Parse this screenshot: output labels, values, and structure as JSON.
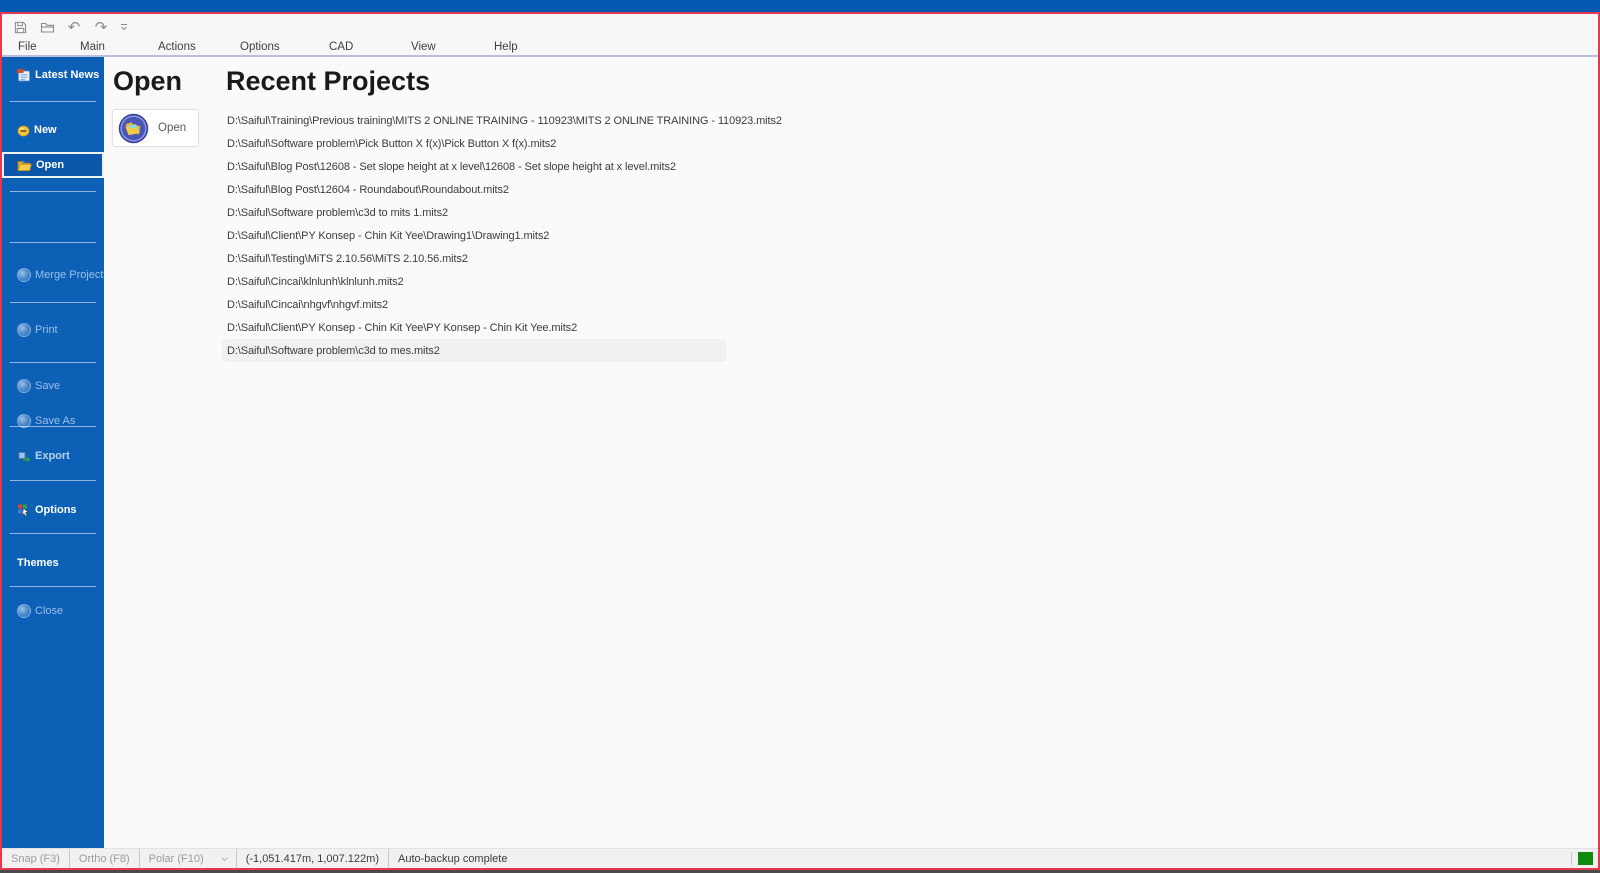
{
  "quick_access_toolbar": {
    "icons": [
      "save-icon",
      "open-folder-icon",
      "undo-icon",
      "redo-icon",
      "customize-icon"
    ]
  },
  "menu_bar": {
    "items": [
      "File",
      "Main",
      "Actions",
      "Options",
      "CAD",
      "View",
      "Help"
    ]
  },
  "sidebar": {
    "items": [
      {
        "label": "Latest News",
        "state": "enabled"
      },
      {
        "label": "New",
        "state": "enabled"
      },
      {
        "label": "Open",
        "state": "selected"
      },
      {
        "label": "Merge Project",
        "state": "disabled"
      },
      {
        "label": "Print",
        "state": "disabled"
      },
      {
        "label": "Save",
        "state": "disabled"
      },
      {
        "label": "Save As",
        "state": "disabled"
      },
      {
        "label": "Export",
        "state": "enabled"
      },
      {
        "label": "Options",
        "state": "enabled"
      },
      {
        "label": "Themes",
        "state": "enabled"
      },
      {
        "label": "Close",
        "state": "disabled"
      }
    ]
  },
  "main": {
    "section_title": "Open",
    "open_button_label": "Open",
    "recent_title": "Recent Projects",
    "recent_projects": [
      "D:\\Saiful\\Training\\Previous training\\MITS 2 ONLINE TRAINING - 110923\\MITS 2 ONLINE TRAINING - 110923.mits2",
      "D:\\Saiful\\Software problem\\Pick Button X f(x)\\Pick Button X f(x).mits2",
      "D:\\Saiful\\Blog Post\\12608 - Set slope height at x level\\12608 - Set slope height at x level.mits2",
      "D:\\Saiful\\Blog Post\\12604 - Roundabout\\Roundabout.mits2",
      "D:\\Saiful\\Software problem\\c3d to mits 1.mits2",
      "D:\\Saiful\\Client\\PY Konsep - Chin Kit Yee\\Drawing1\\Drawing1.mits2",
      "D:\\Saiful\\Testing\\MiTS 2.10.56\\MiTS 2.10.56.mits2",
      "D:\\Saiful\\Cincai\\klnlunh\\klnlunh.mits2",
      "D:\\Saiful\\Cincai\\nhgvf\\nhgvf.mits2",
      "D:\\Saiful\\Client\\PY Konsep - Chin Kit Yee\\PY Konsep - Chin Kit Yee.mits2",
      "D:\\Saiful\\Software problem\\c3d to mes.mits2"
    ],
    "highlighted_project_index": 10
  },
  "status_bar": {
    "snap": "Snap (F3)",
    "ortho": "Ortho (F8)",
    "polar": "Polar (F10)",
    "coordinates": "(-1,051.417m, 1,007.122m)",
    "message": "Auto-backup complete",
    "indicator_color": "#0f8b0f"
  },
  "colors": {
    "titlebar": "#0558b0",
    "sidebar": "#0c60b6",
    "sidebar_selected": "#0a56a9",
    "window_border": "#e63950",
    "menu_underline": "#b9bfdb",
    "status_indicator": "#0f8b0f"
  }
}
